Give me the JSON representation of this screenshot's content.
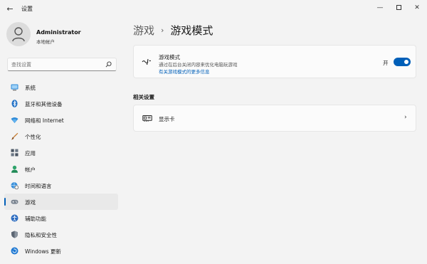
{
  "window": {
    "title": "设置",
    "back_glyph": "←",
    "minimize_glyph": "—",
    "close_glyph": "✕"
  },
  "profile": {
    "name": "Administrator",
    "account_type": "本地帐户"
  },
  "search": {
    "placeholder": "查找设置"
  },
  "sidebar": {
    "items": [
      {
        "label": "系统",
        "icon": "monitor-icon"
      },
      {
        "label": "蓝牙和其他设备",
        "icon": "bluetooth-icon"
      },
      {
        "label": "网络和 Internet",
        "icon": "wifi-icon"
      },
      {
        "label": "个性化",
        "icon": "brush-icon"
      },
      {
        "label": "应用",
        "icon": "apps-icon"
      },
      {
        "label": "帐户",
        "icon": "person-icon"
      },
      {
        "label": "时间和语言",
        "icon": "globe-clock-icon"
      },
      {
        "label": "游戏",
        "icon": "gamepad-icon",
        "selected": true
      },
      {
        "label": "辅助功能",
        "icon": "accessibility-icon"
      },
      {
        "label": "隐私和安全性",
        "icon": "shield-icon"
      },
      {
        "label": "Windows 更新",
        "icon": "refresh-icon"
      }
    ]
  },
  "main": {
    "breadcrumb_parent": "游戏",
    "breadcrumb_sep": "›",
    "breadcrumb_current": "游戏模式",
    "game_mode": {
      "title": "游戏模式",
      "description": "通过在后台关闭内容来优化电脑玩游戏",
      "link": "有关游戏模式的更多信息",
      "toggle_state": "开",
      "toggle_on": true
    },
    "related_section_title": "相关设置",
    "related": {
      "display_label": "显示卡",
      "chevron": "›"
    }
  },
  "colors": {
    "accent": "#005fb8",
    "background": "#f3f3f3",
    "card": "#fbfbfb"
  }
}
